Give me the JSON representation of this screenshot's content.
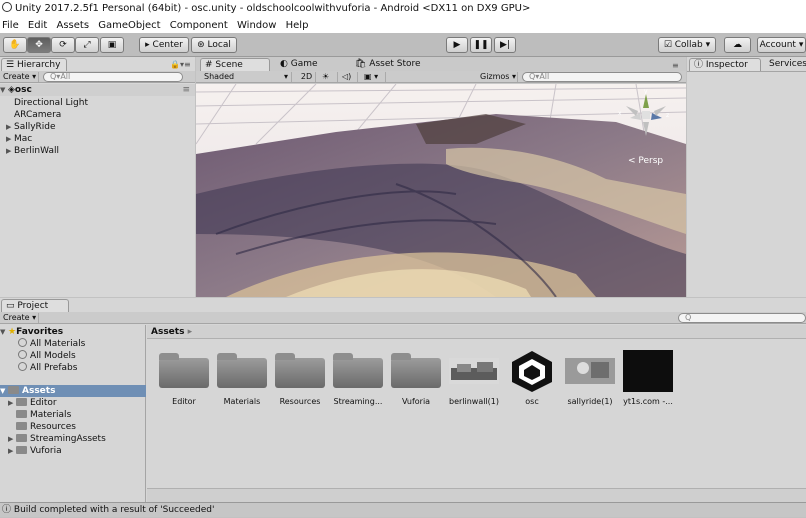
{
  "title": "Unity 2017.2.5f1 Personal (64bit) - osc.unity - oldschoolcoolwithvuforia - Android <DX11 on DX9 GPU>",
  "menu": [
    "File",
    "Edit",
    "Assets",
    "GameObject",
    "Component",
    "Window",
    "Help"
  ],
  "toolbar": {
    "pivot": "Center",
    "space": "Local",
    "collab": "Collab",
    "account": "Account"
  },
  "hierarchy": {
    "tab": "Hierarchy",
    "create": "Create",
    "search": "All",
    "scene": "osc",
    "items": [
      {
        "label": "Directional Light",
        "arrow": ""
      },
      {
        "label": "ARCamera",
        "arrow": ""
      },
      {
        "label": "SallyRide",
        "arrow": "▶"
      },
      {
        "label": "Mac",
        "arrow": "▶"
      },
      {
        "label": "BerlinWall",
        "arrow": "▶"
      }
    ]
  },
  "scene": {
    "tab": "Scene",
    "game_tab": "Game",
    "store_tab": "Asset Store",
    "shading": "Shaded",
    "mode2d": "2D",
    "gizmos": "Gizmos",
    "search": "All",
    "persp": "< Persp"
  },
  "inspector": {
    "tab": "Inspector",
    "services_tab": "Services"
  },
  "project": {
    "tab": "Project",
    "create": "Create",
    "favorites": "Favorites",
    "fav_items": [
      "All Materials",
      "All Models",
      "All Prefabs"
    ],
    "assets_root": "Assets",
    "folders": [
      {
        "label": "Editor",
        "arrow": "▶"
      },
      {
        "label": "Materials",
        "arrow": ""
      },
      {
        "label": "Resources",
        "arrow": ""
      },
      {
        "label": "StreamingAssets",
        "arrow": "▶"
      },
      {
        "label": "Vuforia",
        "arrow": "▶"
      }
    ],
    "breadcrumb": "Assets",
    "grid": [
      "Editor",
      "Materials",
      "Resources",
      "Streaming...",
      "Vuforia",
      "berlinwall(1)",
      "osc",
      "sallyride(1)",
      "yt1s.com -..."
    ]
  },
  "status": "Build completed with a result of 'Succeeded'"
}
